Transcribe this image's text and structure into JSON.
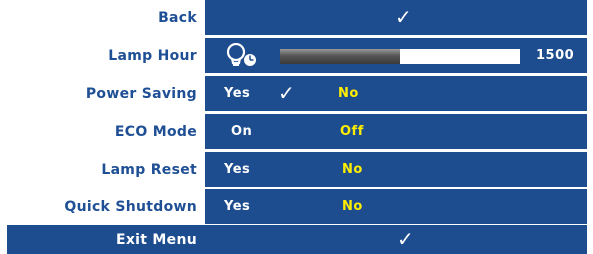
{
  "menu": {
    "back": {
      "label": "Back",
      "check": "✓"
    },
    "lamp_hour": {
      "label": "Lamp Hour",
      "value": "1500",
      "fill_fraction": 0.5,
      "icon": "lamp-hour-icon"
    },
    "power_saving": {
      "label": "Power Saving",
      "opt1": "Yes",
      "check": "✓",
      "opt2": "No"
    },
    "eco_mode": {
      "label": "ECO Mode",
      "opt1": "On",
      "opt2": "Off"
    },
    "lamp_reset": {
      "label": "Lamp Reset",
      "opt1": "Yes",
      "opt2": "No"
    },
    "quick_shutdown": {
      "label": "Quick Shutdown",
      "opt1": "Yes",
      "opt2": "No"
    },
    "exit": {
      "label": "Exit Menu",
      "check": "✓"
    }
  },
  "colors": {
    "menu_blue": "#1d4c8f",
    "label_text": "#1f4f95",
    "highlight_yellow": "#ffee00"
  }
}
